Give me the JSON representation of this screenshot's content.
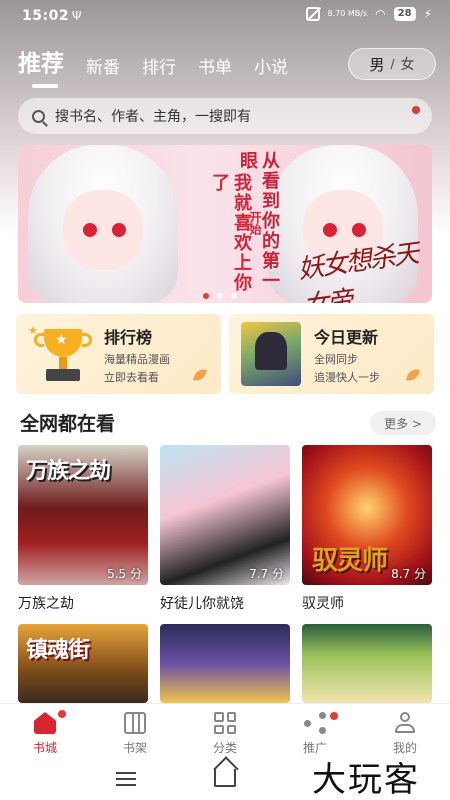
{
  "status": {
    "time": "15:02",
    "usb": "Ψ",
    "speed": "8.70 MB/s",
    "battery": "28"
  },
  "top_tabs": [
    {
      "label": "推荐",
      "active": true
    },
    {
      "label": "新番"
    },
    {
      "label": "排行"
    },
    {
      "label": "书单"
    },
    {
      "label": "小说"
    }
  ],
  "gender": {
    "male": "男",
    "sep": "/",
    "female": "女"
  },
  "search": {
    "placeholder": "搜书名、作者、主角，一搜即有"
  },
  "banner": {
    "line1": "从看到你的第一眼",
    "line2": "我就喜欢上你了",
    "sub": "开始",
    "logo": "妖女想杀天女帝"
  },
  "cards": [
    {
      "title": "排行榜",
      "line1": "海量精品漫画",
      "line2": "立即去看看"
    },
    {
      "title": "今日更新",
      "line1": "全网同步",
      "line2": "追漫快人一步"
    }
  ],
  "section": {
    "title": "全网都在看",
    "more": "更多 >"
  },
  "books": [
    {
      "title": "万族之劫",
      "score": "5.5 分",
      "cover_text": "万族之劫"
    },
    {
      "title": "好徒儿你就饶",
      "score": "7.7 分",
      "cover_text": ""
    },
    {
      "title": "驭灵师",
      "score": "8.7 分",
      "cover_text": "驭灵师"
    },
    {
      "title": "",
      "score": "",
      "cover_text": "镇魂街"
    },
    {
      "title": "",
      "score": "",
      "cover_text": ""
    },
    {
      "title": "",
      "score": "",
      "cover_text": ""
    }
  ],
  "bottom_nav": [
    {
      "label": "书城",
      "icon": "home-icon",
      "active": true,
      "badge": true
    },
    {
      "label": "书架",
      "icon": "bookshelf-icon"
    },
    {
      "label": "分类",
      "icon": "category-icon"
    },
    {
      "label": "推广",
      "icon": "share-icon",
      "badge": true
    },
    {
      "label": "我的",
      "icon": "profile-icon"
    }
  ],
  "watermark": "大玩客"
}
